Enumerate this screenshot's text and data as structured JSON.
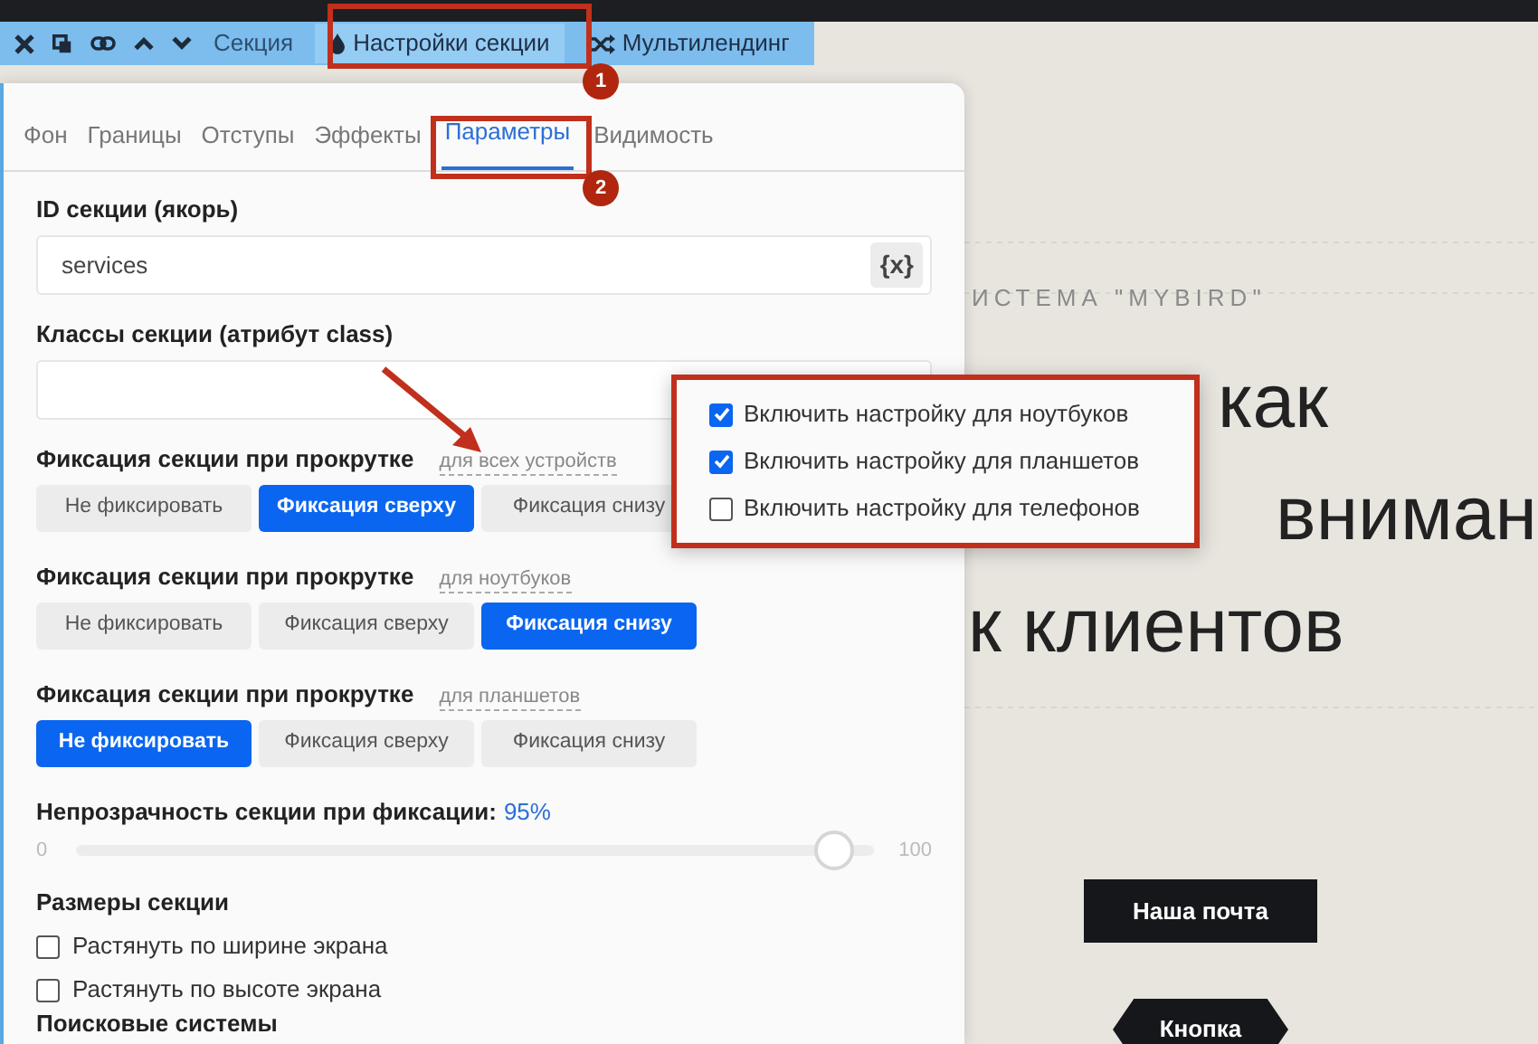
{
  "toolbar": {
    "section_label": "Секция",
    "settings_button": {
      "label": "Настройки секции",
      "selected": true
    },
    "multilanding_button": {
      "label": "Мультилендинг",
      "selected": false
    }
  },
  "tabs": [
    {
      "label": "Фон",
      "selected": false
    },
    {
      "label": "Границы",
      "selected": false
    },
    {
      "label": "Отступы",
      "selected": false
    },
    {
      "label": "Эффекты",
      "selected": false
    },
    {
      "label": "Параметры",
      "selected": true
    },
    {
      "label": "Видимость",
      "selected": false
    }
  ],
  "id_field": {
    "label": "ID секции (якорь)",
    "value": "services",
    "variable_button": "{x}"
  },
  "classes_field": {
    "label": "Классы секции (атрибут class)"
  },
  "fixation_groups": [
    {
      "label": "Фиксация секции при прокрутке",
      "device": "для всех устройств",
      "options": [
        {
          "label": "Не фиксировать",
          "selected": false
        },
        {
          "label": "Фиксация сверху",
          "selected": true
        },
        {
          "label": "Фиксация снизу",
          "selected": false
        }
      ]
    },
    {
      "label": "Фиксация секции при прокрутке",
      "device": "для ноутбуков",
      "options": [
        {
          "label": "Не фиксировать",
          "selected": false
        },
        {
          "label": "Фиксация сверху",
          "selected": false
        },
        {
          "label": "Фиксация снизу",
          "selected": true
        }
      ]
    },
    {
      "label": "Фиксация секции при прокрутке",
      "device": "для планшетов",
      "options": [
        {
          "label": "Не фиксировать",
          "selected": true
        },
        {
          "label": "Фиксация сверху",
          "selected": false
        },
        {
          "label": "Фиксация снизу",
          "selected": false
        }
      ]
    }
  ],
  "opacity": {
    "label": "Непрозрачность секции при фиксации:",
    "value_text": "95%",
    "level": 0.95,
    "min": "0",
    "max": "100"
  },
  "sizes": {
    "title": "Размеры секции",
    "options": [
      {
        "label": "Растянуть по ширине экрана",
        "checked": false
      },
      {
        "label": "Растянуть по высоте экрана",
        "checked": false
      }
    ]
  },
  "next_section_title": "Поисковые системы",
  "device_popup": {
    "options": [
      {
        "label": "Включить настройку для ноутбуков",
        "checked": true
      },
      {
        "label": "Включить настройку для планшетов",
        "checked": true
      },
      {
        "label": "Включить настройку для телефонов",
        "checked": false
      }
    ]
  },
  "annotations": [
    {
      "label": "1"
    },
    {
      "label": "2"
    }
  ],
  "preview": {
    "subtitle": "ИСТЕМА \"MYBIRD\"",
    "heading_lines": [
      "как",
      "вниман",
      "к клиентов"
    ],
    "buttons": [
      {
        "label": "Наша почта",
        "kind": "rect"
      },
      {
        "label": "Кнопка",
        "kind": "hexagon"
      }
    ]
  }
}
